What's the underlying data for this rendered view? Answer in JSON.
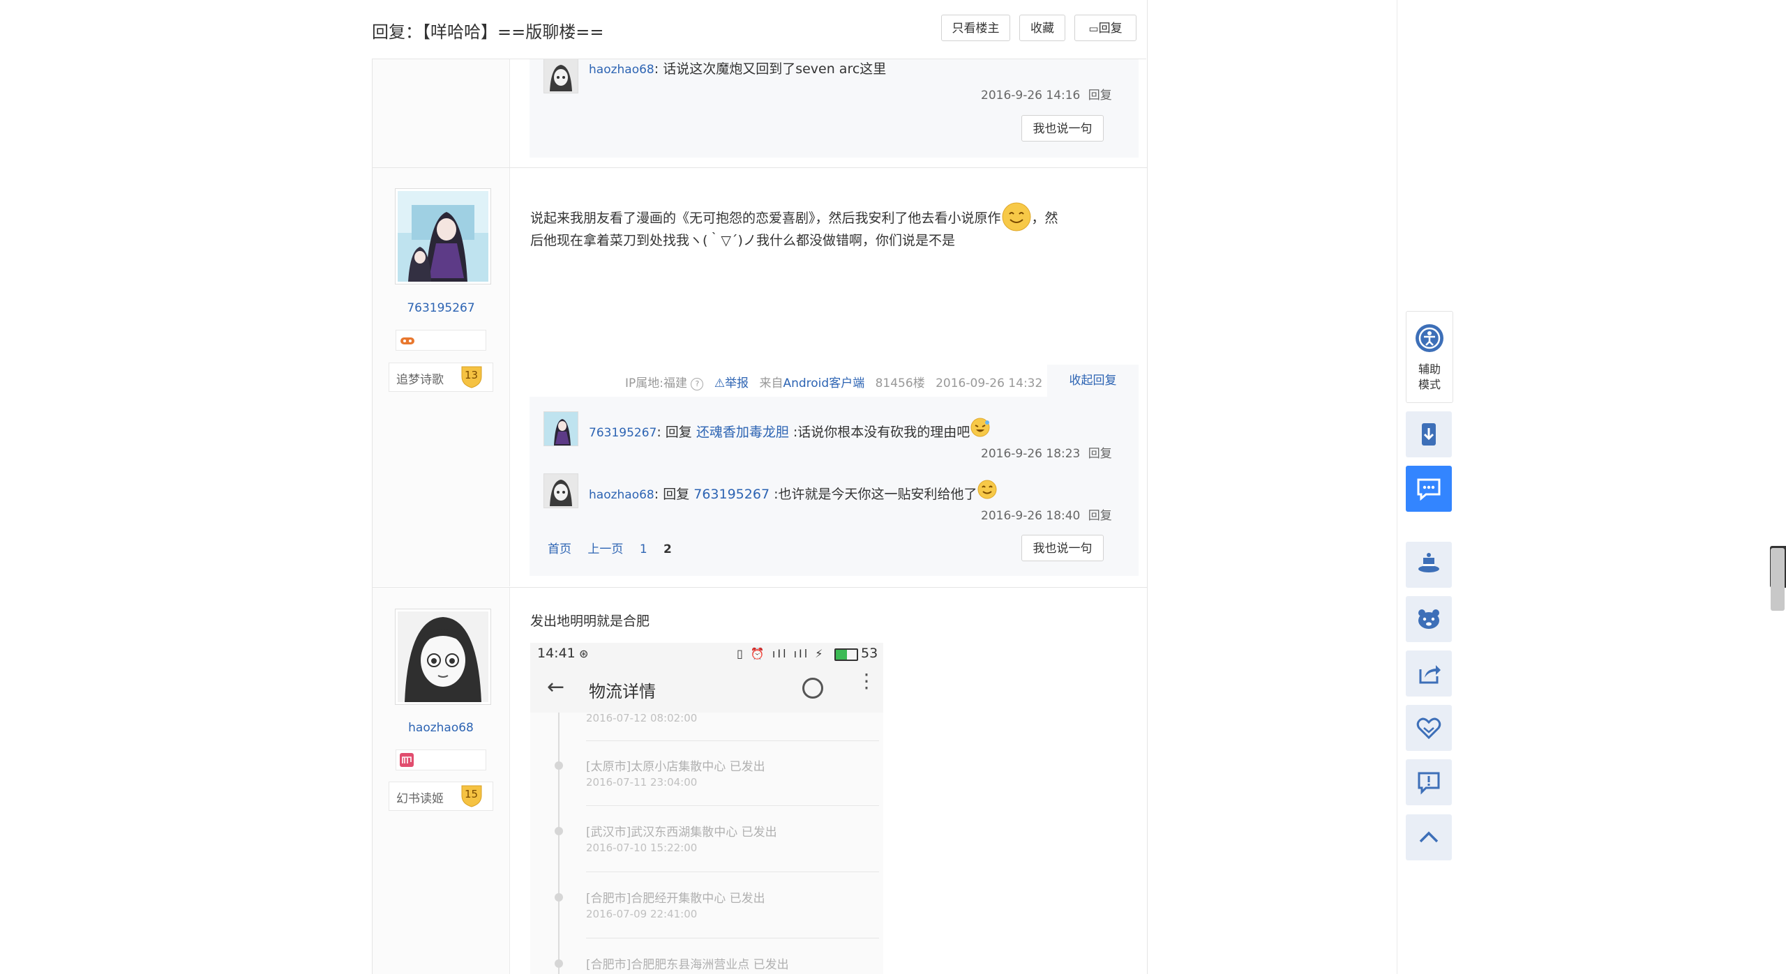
{
  "header": {
    "title": "回复：【咩哈哈】==版聊楼==",
    "only_op": "只看楼主",
    "favorite": "收藏",
    "reply": "回复"
  },
  "floor_top": {
    "sub_reply": {
      "user": "haozhao68",
      "text": ": 话说这次魔炮又回到了seven arc这里",
      "time": "2016-9-26 14:16",
      "reply": "回复"
    },
    "say_btn": "我也说一句"
  },
  "floor_main": {
    "user": "763195267",
    "level_name": "追梦诗歌",
    "level_num": "13",
    "content_line1": "说起来我朋友看了漫画的《无可抱怨的恋爱喜剧》，然后我安利了他去看小说原作",
    "content_line1_end": "，然",
    "content_line2": "后他现在拿着菜刀到处找我ヽ(｀▽´)ノ我什么都没做错啊，你们说是不是",
    "meta": {
      "ip": "IP属地:福建",
      "report": "举报",
      "from": "来自",
      "client": "Android客户端",
      "floor": "81456楼",
      "time": "2016-09-26 14:32",
      "collapse": "收起回复"
    },
    "sub_replies": [
      {
        "user": "763195267",
        "reply_to_prefix": ": 回复 ",
        "reply_to": "还魂香加毒龙胆",
        "text": " :话说你根本没有砍我的理由吧",
        "time": "2016-9-26 18:23",
        "reply": "回复"
      },
      {
        "user": "haozhao68",
        "reply_to_prefix": ": 回复 ",
        "reply_to": "763195267",
        "text": " :也许就是今天你这一贴安利给他了",
        "time": "2016-9-26 18:40",
        "reply": "回复"
      }
    ],
    "pager": {
      "first": "首页",
      "prev": "上一页",
      "p1": "1",
      "p2": "2"
    },
    "say_btn": "我也说一句"
  },
  "floor_next": {
    "user": "haozhao68",
    "level_name": "幻书读姬",
    "level_num": "15",
    "content": "发出地明明就是合肥",
    "image": {
      "status_time": "14:41",
      "battery": "53",
      "title": "物流详情",
      "entries": [
        {
          "place": "",
          "date": "2016-07-12 08:02:00"
        },
        {
          "place": "[太原市]太原小店集散中心 已发出",
          "date": "2016-07-11 23:04:00"
        },
        {
          "place": "[武汉市]武汉东西湖集散中心 已发出",
          "date": "2016-07-10 15:22:00"
        },
        {
          "place": "[合肥市]合肥经开集散中心 已发出",
          "date": "2016-07-09 22:41:00"
        },
        {
          "place": "[合肥市]合肥肥东县海洲营业点 已发出",
          "date": ""
        }
      ]
    }
  },
  "right_rail": {
    "assist_label_1": "辅助",
    "assist_label_2": "模式"
  },
  "colors": {
    "link": "#2d64b3",
    "accent": "#3385ff",
    "level_badge": "#f5c242"
  }
}
